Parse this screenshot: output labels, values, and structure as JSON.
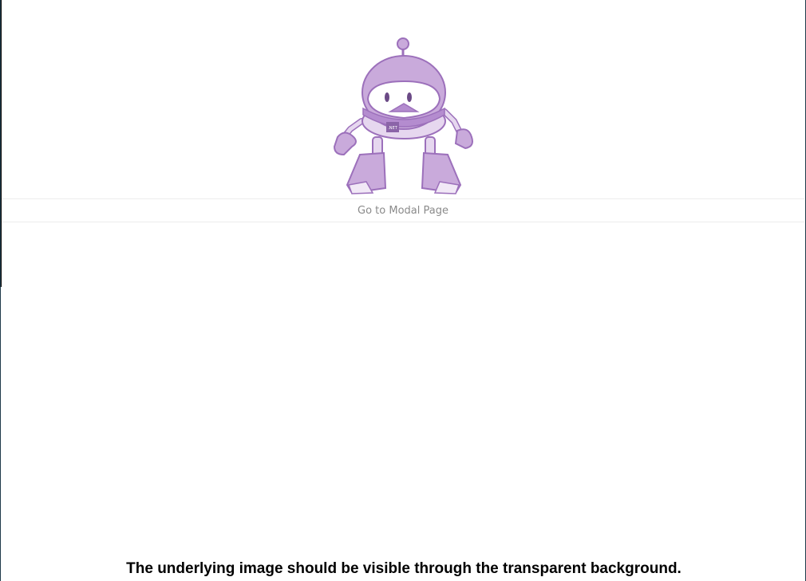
{
  "main": {
    "robot_image": "dotnet-bot-robot-illustration",
    "nav_button_label": "Go to Modal Page"
  },
  "footer": {
    "caption": "The underlying image should be visible through the transparent background."
  },
  "colors": {
    "robot_purple": "#c9aadb",
    "robot_outline": "#9c70bb",
    "button_text": "#8a8a8a",
    "window_border": "#1f3a4a"
  }
}
